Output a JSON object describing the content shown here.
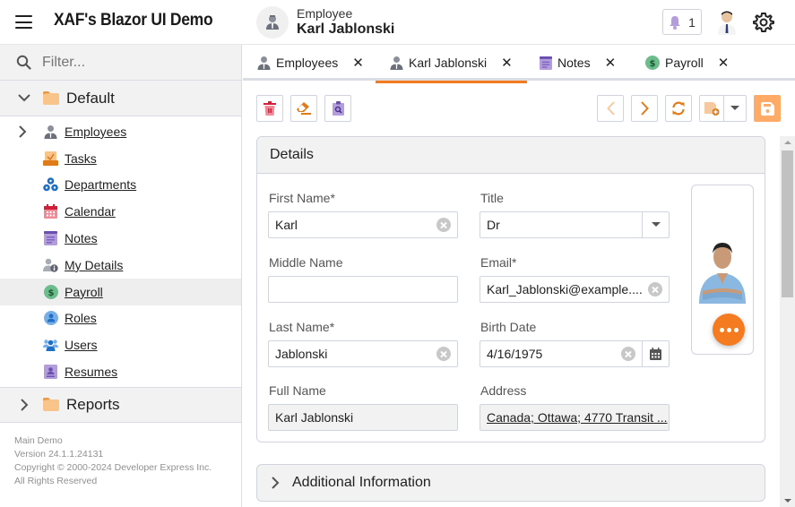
{
  "header": {
    "app_title": "XAF's Blazor UI Demo",
    "context_subtitle": "Employee",
    "context_title": "Karl Jablonski",
    "notification_count": "1",
    "icons": {
      "menu": "hamburger-icon",
      "bell": "bell-icon",
      "user": "user-photo",
      "settings": "gear-icon"
    }
  },
  "sidebar": {
    "filter_placeholder": "Filter...",
    "groups": [
      {
        "label": "Default",
        "expanded": true
      },
      {
        "label": "Reports",
        "expanded": false
      }
    ],
    "items": [
      {
        "label": "Employees",
        "icon": "employee-icon",
        "expandable": true
      },
      {
        "label": "Tasks",
        "icon": "tasks-icon"
      },
      {
        "label": "Departments",
        "icon": "departments-icon"
      },
      {
        "label": "Calendar",
        "icon": "calendar-icon"
      },
      {
        "label": "Notes",
        "icon": "notes-icon"
      },
      {
        "label": "My Details",
        "icon": "my-details-icon"
      },
      {
        "label": "Payroll",
        "icon": "payroll-icon",
        "selected": true
      },
      {
        "label": "Roles",
        "icon": "roles-icon"
      },
      {
        "label": "Users",
        "icon": "users-icon"
      },
      {
        "label": "Resumes",
        "icon": "resumes-icon"
      }
    ],
    "footer": {
      "line1": "Main Demo",
      "line2": "Version 24.1.1.24131",
      "line3": "Copyright © 2000-2024 Developer Express Inc.",
      "line4": "All Rights Reserved"
    }
  },
  "tabs": [
    {
      "label": "Employees",
      "icon": "employee-icon"
    },
    {
      "label": "Karl Jablonski",
      "icon": "employee-icon",
      "active": true
    },
    {
      "label": "Notes",
      "icon": "notes-icon"
    },
    {
      "label": "Payroll",
      "icon": "payroll-icon"
    }
  ],
  "toolbar": {
    "left": [
      "delete",
      "reset-view-settings",
      "show-in-report"
    ],
    "right": [
      "previous-record",
      "next-record",
      "refresh",
      "save-and-new",
      "save"
    ]
  },
  "details": {
    "title": "Details",
    "fields": {
      "first_name": {
        "label": "First Name*",
        "value": "Karl"
      },
      "title": {
        "label": "Title",
        "value": "Dr"
      },
      "middle_name": {
        "label": "Middle Name",
        "value": ""
      },
      "email": {
        "label": "Email*",
        "value": "Karl_Jablonski@example...."
      },
      "last_name": {
        "label": "Last Name*",
        "value": "Jablonski"
      },
      "birth_date": {
        "label": "Birth Date",
        "value": "4/16/1975"
      },
      "full_name": {
        "label": "Full Name",
        "value": "Karl Jablonski"
      },
      "address": {
        "label": "Address",
        "value": "Canada; Ottawa; 4770 Transit ..."
      }
    }
  },
  "additional": {
    "title": "Additional Information"
  },
  "colors": {
    "accent": "#f47b20",
    "save": "#ffaa66",
    "panel": "#f2f2f2",
    "border": "#d0d4dc"
  }
}
